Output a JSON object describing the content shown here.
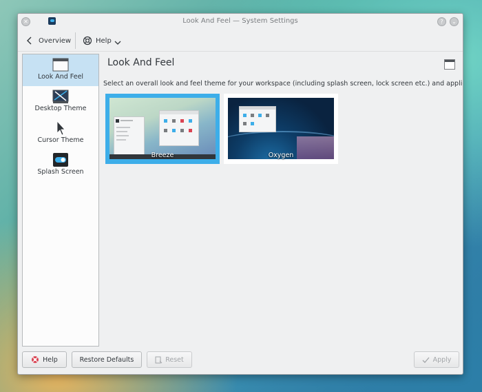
{
  "window": {
    "title": "Look And Feel — System Settings"
  },
  "toolbar": {
    "overview_label": "Overview",
    "help_label": "Help"
  },
  "sidebar": {
    "items": [
      {
        "label": "Look And Feel",
        "icon": "window-icon",
        "active": true
      },
      {
        "label": "Desktop Theme",
        "icon": "desktop-theme-icon",
        "active": false
      },
      {
        "label": "Cursor Theme",
        "icon": "cursor-icon",
        "active": false
      },
      {
        "label": "Splash Screen",
        "icon": "splash-toggle-icon",
        "active": false
      }
    ]
  },
  "content": {
    "title": "Look And Feel",
    "description": "Select an overall look and feel theme for your workspace (including splash screen, lock screen etc.) and applications",
    "themes": [
      {
        "name": "Breeze",
        "selected": true
      },
      {
        "name": "Oxygen",
        "selected": false
      }
    ]
  },
  "buttons": {
    "help": "Help",
    "restore_defaults": "Restore Defaults",
    "reset": "Reset",
    "apply": "Apply"
  },
  "colors": {
    "accent": "#3daee9",
    "sidebar_active": "#c6e1f3",
    "window_bg": "#eff0f1"
  }
}
